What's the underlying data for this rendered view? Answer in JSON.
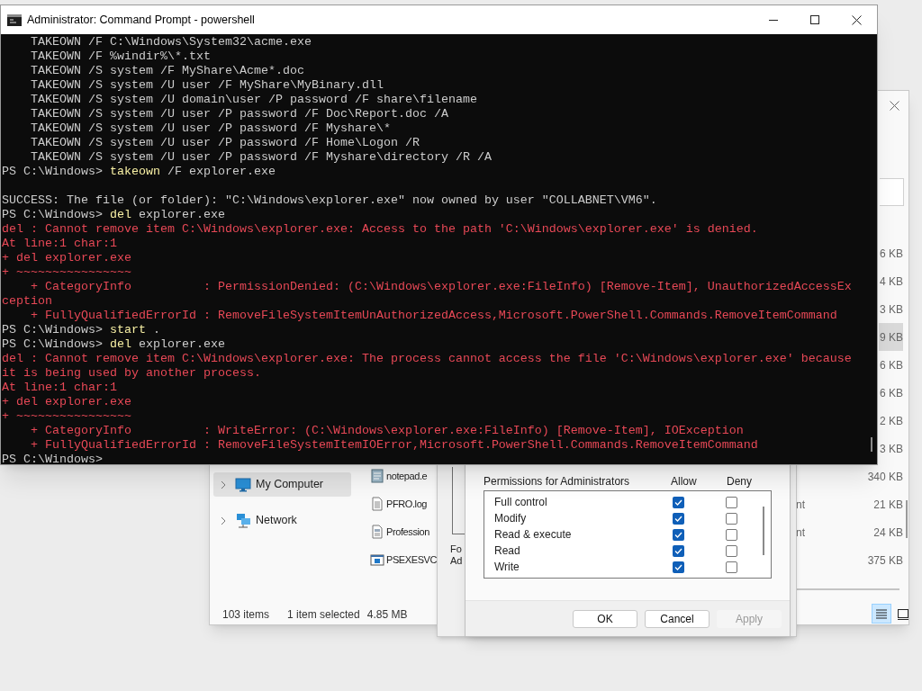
{
  "console": {
    "title": "Administrator: Command Prompt - powershell",
    "lines": [
      {
        "kind": "output",
        "text": "    TAKEOWN /F C:\\Windows\\System32\\acme.exe"
      },
      {
        "kind": "output",
        "text": "    TAKEOWN /F %windir%\\*.txt"
      },
      {
        "kind": "output",
        "text": "    TAKEOWN /S system /F MyShare\\Acme*.doc"
      },
      {
        "kind": "output",
        "text": "    TAKEOWN /S system /U user /F MyShare\\MyBinary.dll"
      },
      {
        "kind": "output",
        "text": "    TAKEOWN /S system /U domain\\user /P password /F share\\filename"
      },
      {
        "kind": "output",
        "text": "    TAKEOWN /S system /U user /P password /F Doc\\Report.doc /A"
      },
      {
        "kind": "output",
        "text": "    TAKEOWN /S system /U user /P password /F Myshare\\*"
      },
      {
        "kind": "output",
        "text": "    TAKEOWN /S system /U user /P password /F Home\\Logon /R"
      },
      {
        "kind": "output",
        "text": "    TAKEOWN /S system /U user /P password /F Myshare\\directory /R /A"
      },
      {
        "kind": "prompt",
        "prompt": "PS C:\\Windows> ",
        "command": "takeown",
        "args": " /F explorer.exe"
      },
      {
        "kind": "blank"
      },
      {
        "kind": "output",
        "text": "SUCCESS: The file (or folder): \"C:\\Windows\\explorer.exe\" now owned by user \"COLLABNET\\VM6\"."
      },
      {
        "kind": "prompt",
        "prompt": "PS C:\\Windows> ",
        "command": "del",
        "args": " explorer.exe"
      },
      {
        "kind": "error",
        "text": "del : Cannot remove item C:\\Windows\\explorer.exe: Access to the path 'C:\\Windows\\explorer.exe' is denied."
      },
      {
        "kind": "error",
        "text": "At line:1 char:1"
      },
      {
        "kind": "error",
        "text": "+ del explorer.exe"
      },
      {
        "kind": "error",
        "text": "+ ~~~~~~~~~~~~~~~~"
      },
      {
        "kind": "error",
        "text": "    + CategoryInfo          : PermissionDenied: (C:\\Windows\\explorer.exe:FileInfo) [Remove-Item], UnauthorizedAccessEx"
      },
      {
        "kind": "error",
        "text": "ception"
      },
      {
        "kind": "error",
        "text": "    + FullyQualifiedErrorId : RemoveFileSystemItemUnAuthorizedAccess,Microsoft.PowerShell.Commands.RemoveItemCommand"
      },
      {
        "kind": "prompt",
        "prompt": "PS C:\\Windows> ",
        "command": "start",
        "args": " ."
      },
      {
        "kind": "prompt",
        "prompt": "PS C:\\Windows> ",
        "command": "del",
        "args": " explorer.exe"
      },
      {
        "kind": "error",
        "text": "del : Cannot remove item C:\\Windows\\explorer.exe: The process cannot access the file 'C:\\Windows\\explorer.exe' because"
      },
      {
        "kind": "error",
        "text": "it is being used by another process."
      },
      {
        "kind": "error",
        "text": "At line:1 char:1"
      },
      {
        "kind": "error",
        "text": "+ del explorer.exe"
      },
      {
        "kind": "error",
        "text": "+ ~~~~~~~~~~~~~~~~"
      },
      {
        "kind": "error",
        "text": "    + CategoryInfo          : WriteError: (C:\\Windows\\explorer.exe:FileInfo) [Remove-Item], IOException"
      },
      {
        "kind": "error",
        "text": "    + FullyQualifiedErrorId : RemoveFileSystemItemIOError,Microsoft.PowerShell.Commands.RemoveItemCommand"
      },
      {
        "kind": "prompt",
        "prompt": "PS C:\\Windows>"
      }
    ]
  },
  "explorer": {
    "sidebar": [
      {
        "label": "My Computer",
        "kind": "computer",
        "selected": true
      },
      {
        "label": "Network",
        "kind": "network",
        "selected": false
      }
    ],
    "files": [
      {
        "size": "6 KB",
        "selected": false
      },
      {
        "size": "4 KB",
        "selected": false
      },
      {
        "size": "3 KB",
        "selected": false
      },
      {
        "size": "9 KB",
        "selected": true
      },
      {
        "size": "6 KB",
        "selected": false
      },
      {
        "size": "6 KB",
        "selected": false
      },
      {
        "size": "2 KB",
        "selected": false
      },
      {
        "size": "3 KB",
        "selected": false
      },
      {
        "kind": "notepad",
        "name": "notepad.e",
        "size": "340 KB",
        "selected": false
      },
      {
        "kind": "log",
        "name": "PFRO.log",
        "type": "nt",
        "size": "21 KB",
        "selected": false
      },
      {
        "kind": "xml",
        "name": "Profession",
        "type": "nt",
        "size": "24 KB",
        "selected": false
      },
      {
        "kind": "app",
        "name": "PSEXESVC",
        "size": "375 KB",
        "selected": false
      }
    ],
    "status": {
      "count": "103 items",
      "selection": "1 item selected",
      "size": "4.85 MB"
    },
    "views": [
      {
        "kind": "details",
        "selected": true
      },
      {
        "kind": "tiles",
        "selected": false
      }
    ]
  },
  "properties_dialog": {
    "label_lines": [
      "Fo",
      "Ad"
    ]
  },
  "permissions_dialog": {
    "header": "Permissions for Administrators",
    "allow_header": "Allow",
    "deny_header": "Deny",
    "permissions": [
      {
        "name": "Full control",
        "allow": true,
        "deny": false
      },
      {
        "name": "Modify",
        "allow": true,
        "deny": false
      },
      {
        "name": "Read & execute",
        "allow": true,
        "deny": false
      },
      {
        "name": "Read",
        "allow": true,
        "deny": false
      },
      {
        "name": "Write",
        "allow": true,
        "deny": false
      }
    ],
    "buttons": [
      {
        "label": "OK",
        "disabled": false
      },
      {
        "label": "Cancel",
        "disabled": false
      },
      {
        "label": "Apply",
        "disabled": true
      }
    ]
  }
}
